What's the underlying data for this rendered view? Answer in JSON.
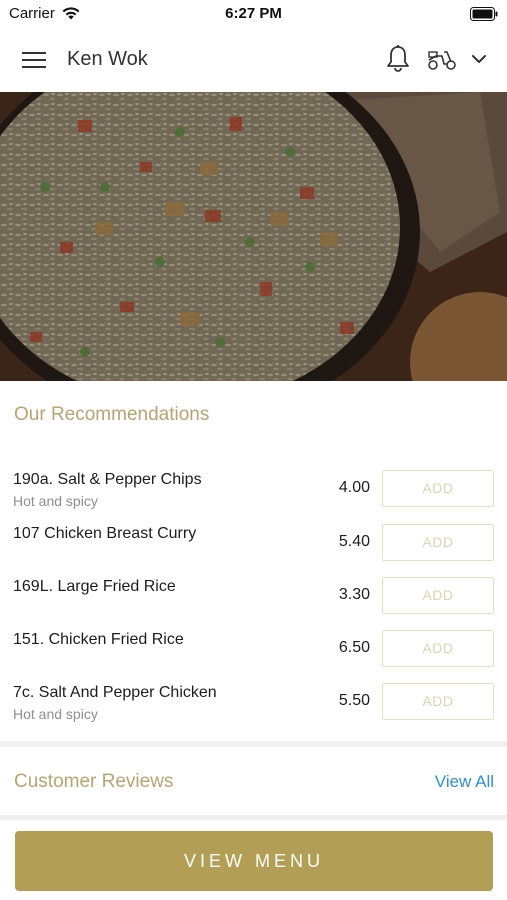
{
  "status_bar": {
    "carrier": "Carrier",
    "time": "6:27 PM"
  },
  "header": {
    "restaurant_name": "Ken Wok",
    "icons": [
      "menu-icon",
      "bell-icon",
      "scooter-icon",
      "chevron-down-icon"
    ]
  },
  "recommendations": {
    "title": "Our Recommendations",
    "add_label": "ADD",
    "items": [
      {
        "name": "190a. Salt & Pepper Chips",
        "description": "Hot and spicy",
        "price": "4.00"
      },
      {
        "name": "107 Chicken Breast Curry",
        "description": "",
        "price": "5.40"
      },
      {
        "name": "169L. Large Fried Rice",
        "description": "",
        "price": "3.30"
      },
      {
        "name": "151. Chicken Fried Rice",
        "description": "",
        "price": "6.50"
      },
      {
        "name": "7c. Salt And Pepper Chicken",
        "description": "Hot and spicy",
        "price": "5.50"
      }
    ]
  },
  "reviews": {
    "title": "Customer Reviews",
    "view_all_label": "View All"
  },
  "bottom": {
    "view_menu_label": "VIEW MENU"
  },
  "colors": {
    "accent_gold": "#b39e55",
    "section_title": "#b6a473",
    "link_blue": "#2f8fd1"
  }
}
